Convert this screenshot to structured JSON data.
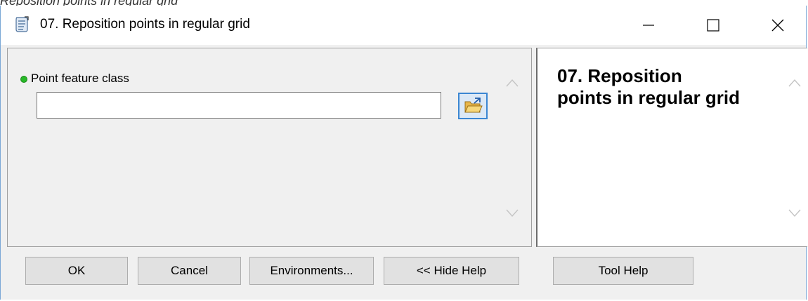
{
  "clipped_heading": "Reposition points in regular grid",
  "window": {
    "title": "07. Reposition points in regular grid",
    "icon": "script-scroll-icon"
  },
  "parameters": [
    {
      "label": "Point feature class",
      "value": "",
      "required": true,
      "status_color": "#28b828"
    }
  ],
  "help_panel": {
    "title": "07. Reposition points in regular grid"
  },
  "buttons": {
    "ok": "OK",
    "cancel": "Cancel",
    "environments": "Environments...",
    "hide_help": "<< Hide Help",
    "tool_help": "Tool Help"
  },
  "colors": {
    "window_border": "#7aa7d6",
    "browse_border": "#3b86d2",
    "required_dot": "#28b828"
  }
}
